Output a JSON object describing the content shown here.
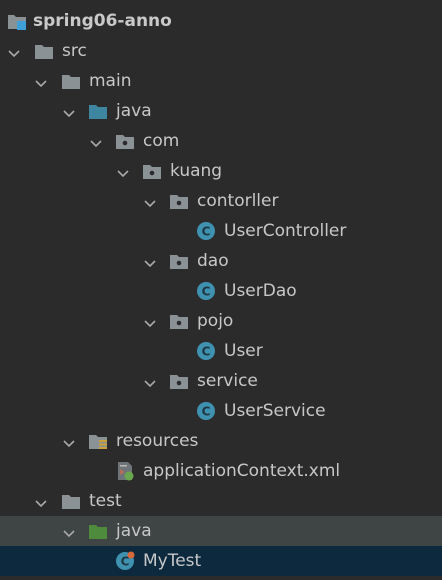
{
  "project_tree": {
    "items": [
      {
        "label": "spring06-anno"
      },
      {
        "label": "src"
      },
      {
        "label": "main"
      },
      {
        "label": "java"
      },
      {
        "label": "com"
      },
      {
        "label": "kuang"
      },
      {
        "label": "contorller"
      },
      {
        "label": "UserController"
      },
      {
        "label": "dao"
      },
      {
        "label": "UserDao"
      },
      {
        "label": "pojo"
      },
      {
        "label": "User"
      },
      {
        "label": "service"
      },
      {
        "label": "UserService"
      },
      {
        "label": "resources"
      },
      {
        "label": "applicationContext.xml"
      },
      {
        "label": "test"
      },
      {
        "label": "java"
      },
      {
        "label": "MyTest"
      }
    ]
  },
  "colors": {
    "background": "#2b2b2b",
    "text": "#c7c7c7",
    "folder": "#8a9296",
    "source_folder": "#3e86a0",
    "test_folder": "#4e8b3d",
    "class_icon": "#3f91b0",
    "selection_focus": "#0d293e",
    "selection_inactive": "#3e4544"
  }
}
